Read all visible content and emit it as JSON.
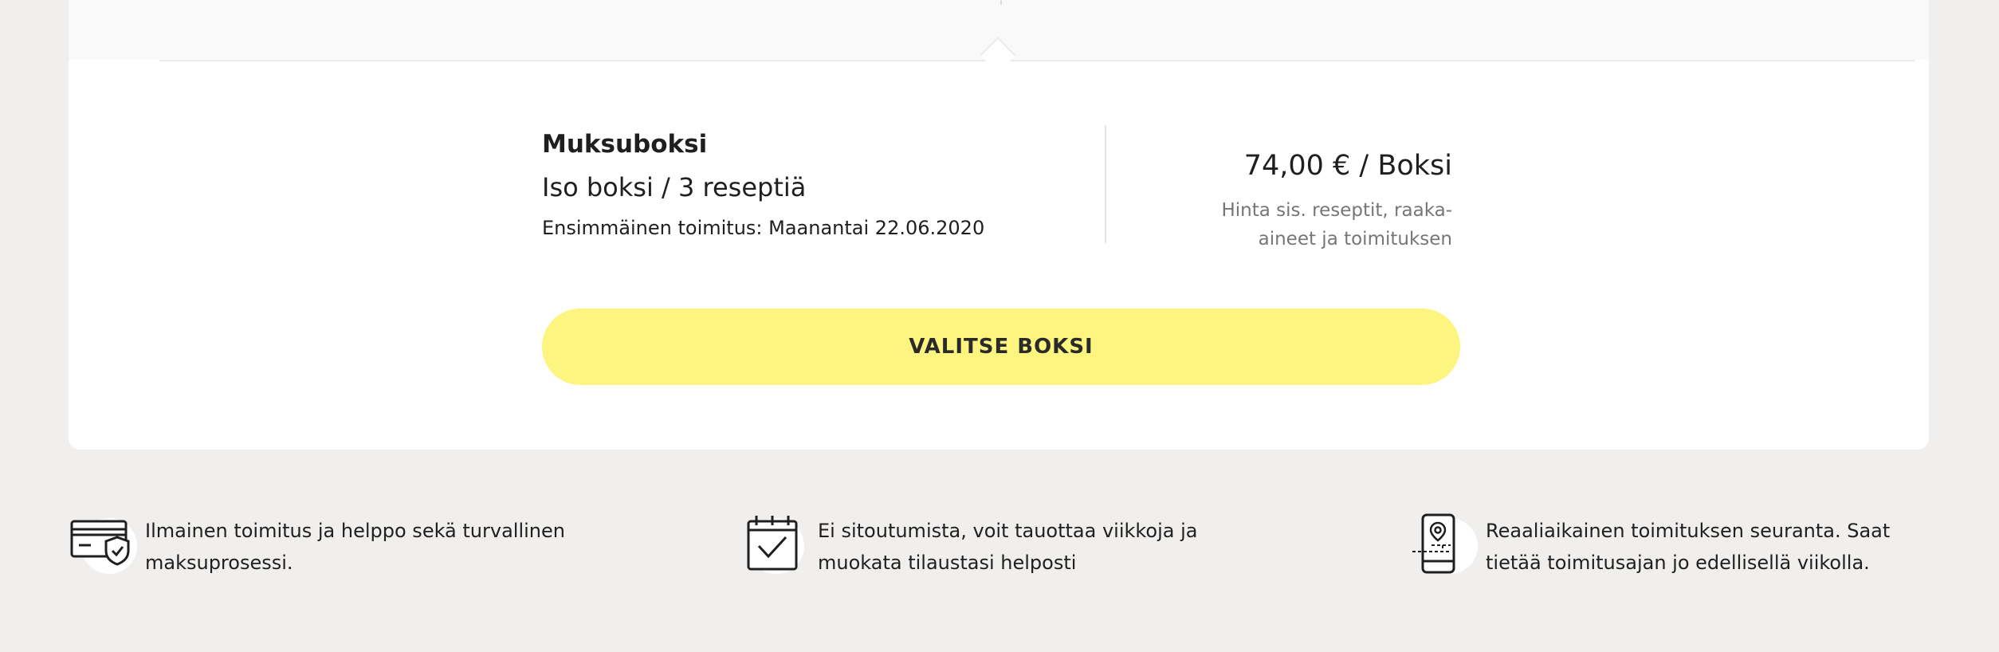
{
  "product": {
    "name": "Muksuboksi",
    "size": "Iso boksi / 3 reseptiä",
    "first_delivery": "Ensimmäinen toimitus: Maanantai 22.06.2020"
  },
  "pricing": {
    "price": "74,00 € / Boksi",
    "note": "Hinta sis. reseptit, raaka-aineet ja toimituksen"
  },
  "cta": {
    "label": "VALITSE BOKSI",
    "color": "#fdf57f"
  },
  "features": [
    {
      "icon": "credit-card-shield-icon",
      "line1": "Ilmainen toimitus ja helppo sekä turvallinen",
      "line2": "maksuprosessi."
    },
    {
      "icon": "calendar-check-icon",
      "line1": "Ei sitoutumista, voit tauottaa viikkoja ja",
      "line2": "muokata tilaustasi helposti"
    },
    {
      "icon": "phone-location-icon",
      "line1": "Reaaliaikainen toimituksen seuranta. Saat",
      "line2": "tietää toimitusajan jo edellisellä viikolla."
    }
  ]
}
